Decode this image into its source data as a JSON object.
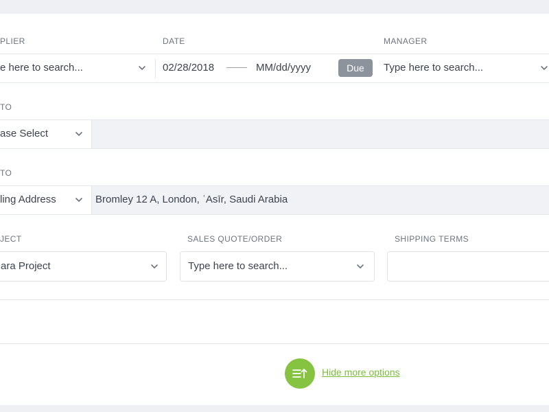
{
  "row1": {
    "supplier": {
      "label": "PLIER",
      "placeholder": "e here to search..."
    },
    "date": {
      "label": "DATE",
      "from": "02/28/2018",
      "to": "MM/dd/yyyy",
      "due_label": "Due"
    },
    "manager": {
      "label": "MANAGER",
      "placeholder": "Type here to search..."
    }
  },
  "row2": {
    "label": "TO",
    "select_value": "ase Select",
    "field_value": ""
  },
  "row3": {
    "label": "TO",
    "select_value": "ling Address",
    "field_value": "Bromley 12 A, London, ʿAsīr, Saudi Arabia"
  },
  "row4": {
    "project": {
      "label": "JECT",
      "value": "ara Project"
    },
    "sales_quote": {
      "label": "SALES QUOTE/ORDER",
      "placeholder": "Type here to search..."
    },
    "shipping_terms": {
      "label": "SHIPPING TERMS",
      "value": ""
    }
  },
  "footer": {
    "toggle_label": "Hide more options"
  },
  "colors": {
    "accent": "#86c341",
    "due_badge": "#8c939c"
  },
  "icons": [
    "chevron-down-icon",
    "list-collapse-icon"
  ]
}
